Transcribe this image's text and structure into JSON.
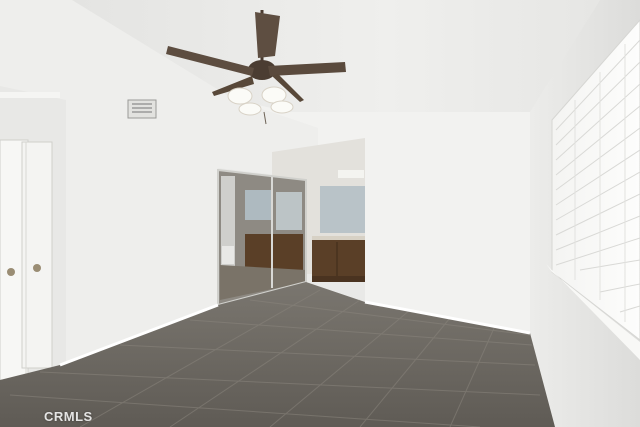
{
  "watermark": {
    "text": "CRMLS"
  },
  "colors": {
    "wall": "#f1f1ef",
    "ceiling": "#ebebe9",
    "floor": "#6e6a64",
    "cabinet": "#5a3f27",
    "door": "#f7f7f5"
  }
}
